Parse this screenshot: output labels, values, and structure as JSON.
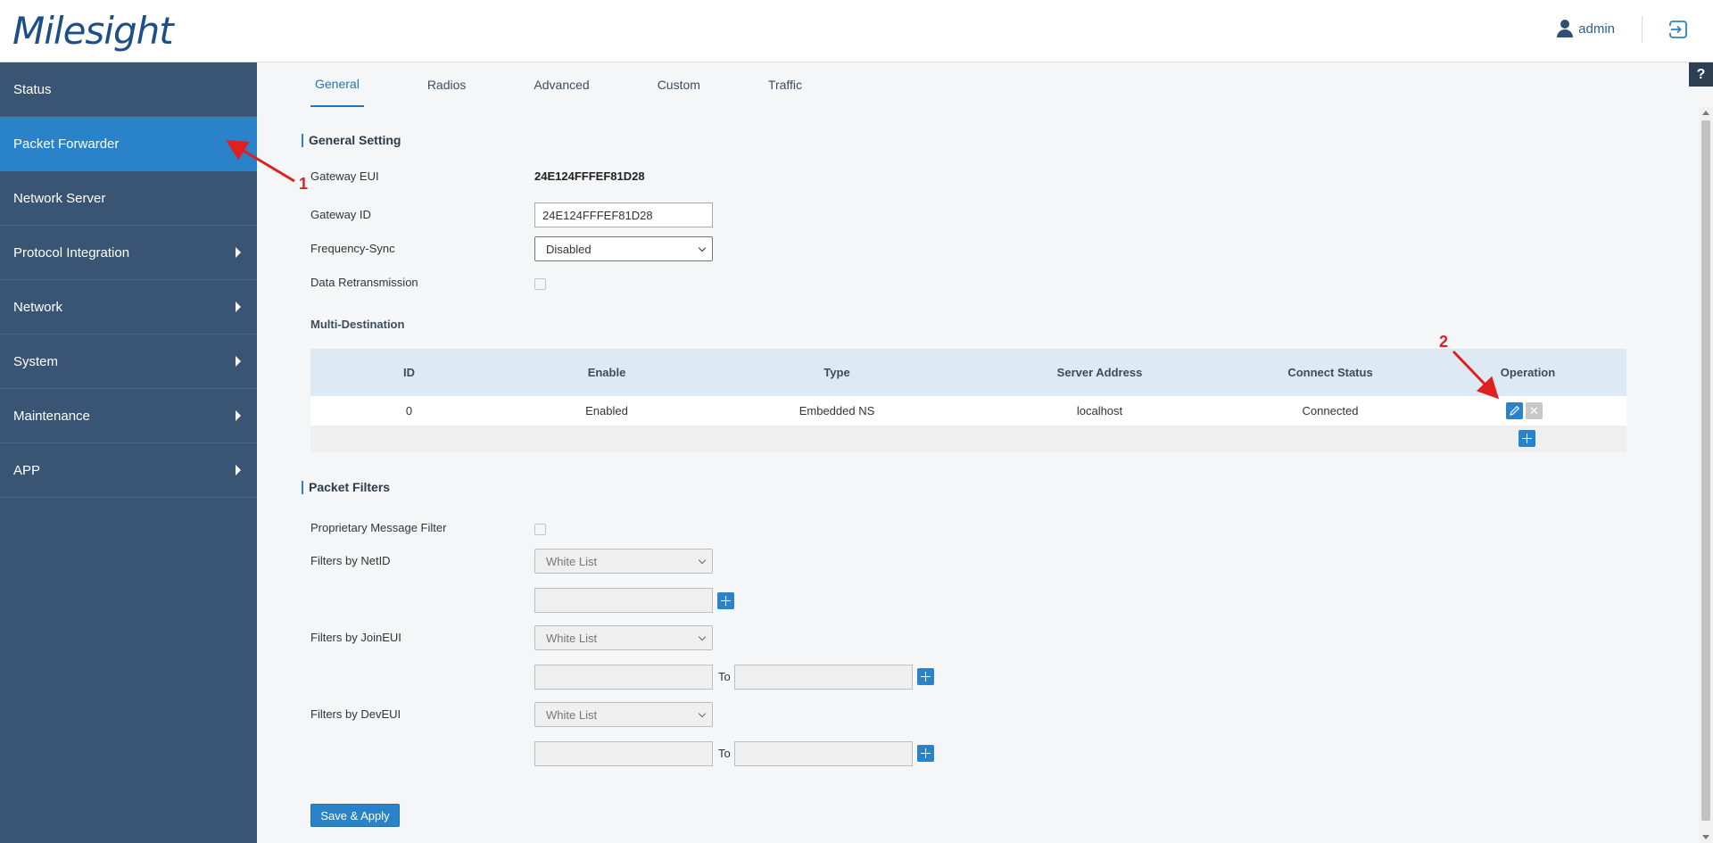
{
  "header": {
    "logo": "Milesight",
    "user_name": "admin"
  },
  "sidebar": {
    "items": [
      {
        "label": "Status"
      },
      {
        "label": "Packet Forwarder"
      },
      {
        "label": "Network Server"
      },
      {
        "label": "Protocol Integration"
      },
      {
        "label": "Network"
      },
      {
        "label": "System"
      },
      {
        "label": "Maintenance"
      },
      {
        "label": "APP"
      }
    ]
  },
  "tabs": [
    "General",
    "Radios",
    "Advanced",
    "Custom",
    "Traffic"
  ],
  "help": "?",
  "general_setting": {
    "title": "General Setting",
    "gateway_eui_label": "Gateway EUI",
    "gateway_eui_value": "24E124FFFEF81D28",
    "gateway_id_label": "Gateway ID",
    "gateway_id_value": "24E124FFFEF81D28",
    "frequency_sync_label": "Frequency-Sync",
    "frequency_sync_value": "Disabled",
    "data_retransmission_label": "Data Retransmission"
  },
  "multi_destination": {
    "title": "Multi-Destination",
    "headers": [
      "ID",
      "Enable",
      "Type",
      "Server Address",
      "Connect Status",
      "Operation"
    ],
    "rows": [
      {
        "id": "0",
        "enable": "Enabled",
        "type": "Embedded NS",
        "server_address": "localhost",
        "connect_status": "Connected"
      }
    ]
  },
  "packet_filters": {
    "title": "Packet Filters",
    "proprietary_label": "Proprietary Message Filter",
    "netid_label": "Filters by NetID",
    "netid_select": "White List",
    "joineui_label": "Filters by JoinEUI",
    "joineui_select": "White List",
    "deveui_label": "Filters by DevEUI",
    "deveui_select": "White List",
    "to_label": "To"
  },
  "save_label": "Save & Apply",
  "annotations": [
    "1",
    "2"
  ],
  "colors": {
    "sidebar_bg": "#3a5573",
    "sidebar_active": "#2a82c8",
    "accent": "#2a82c8",
    "annotation": "#e02020"
  }
}
